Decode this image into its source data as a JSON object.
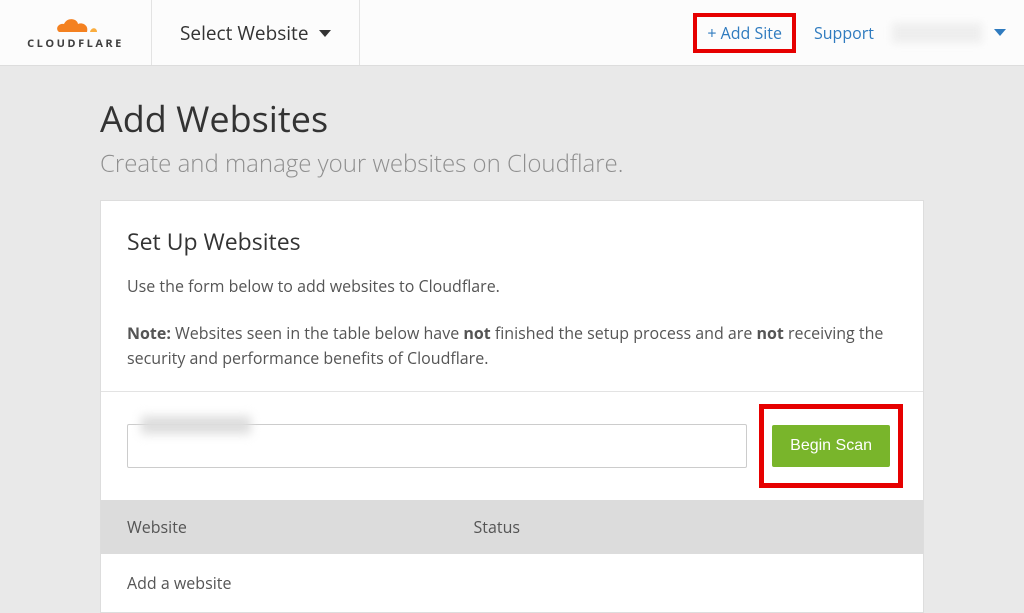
{
  "brand": {
    "name": "CLOUDFLARE"
  },
  "header": {
    "selector_label": "Select Website",
    "add_site": "+ Add Site",
    "support": "Support"
  },
  "page": {
    "title": "Add Websites",
    "subtitle": "Create and manage your websites on Cloudflare."
  },
  "setup": {
    "heading": "Set Up Websites",
    "intro": "Use the form below to add websites to Cloudflare.",
    "note_prefix": "Note:",
    "note_part1": " Websites seen in the table below have ",
    "note_bold1": "not",
    "note_part2": " finished the setup process and are ",
    "note_bold2": "not",
    "note_part3": " receiving the security and performance benefits of Cloudflare.",
    "begin_scan": "Begin Scan",
    "input_placeholder": ""
  },
  "table": {
    "col_website": "Website",
    "col_status": "Status",
    "empty_row": "Add a website"
  }
}
